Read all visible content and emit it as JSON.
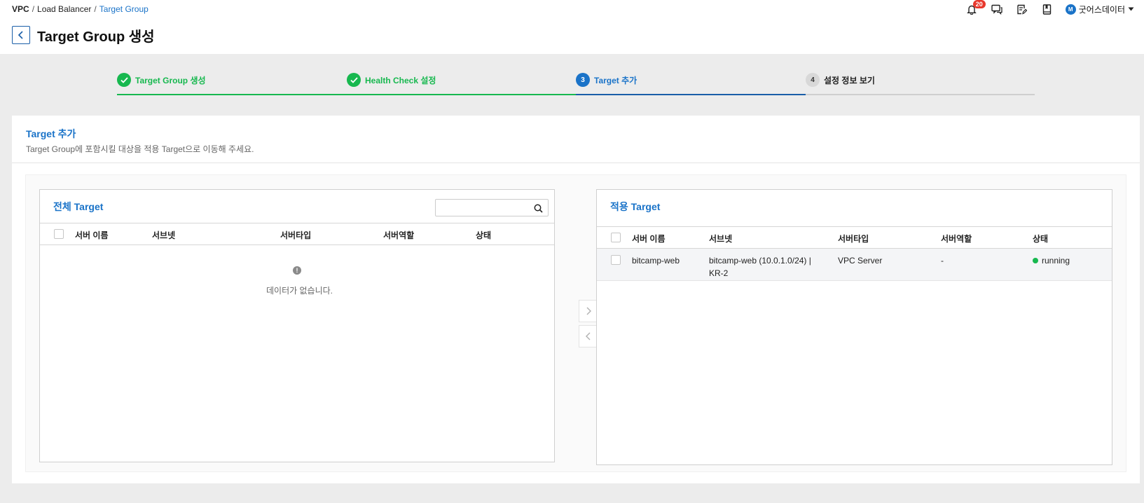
{
  "breadcrumb": {
    "items": [
      "VPC",
      "Load Balancer",
      "Target Group"
    ],
    "separator": "/"
  },
  "page_title": "Target Group 생성",
  "header": {
    "notification_count": "20",
    "user_initial": "M",
    "user_name": "굿어스데이터"
  },
  "stepper": [
    {
      "label": "Target Group 생성",
      "state": "done",
      "number": "1"
    },
    {
      "label": "Health Check 설정",
      "state": "done",
      "number": "2"
    },
    {
      "label": "Target 추가",
      "state": "active",
      "number": "3"
    },
    {
      "label": "설정 정보 보기",
      "state": "todo",
      "number": "4"
    }
  ],
  "section": {
    "title": "Target 추가",
    "description": "Target Group에 포함시킬 대상을 적용 Target으로 이동해 주세요."
  },
  "all_targets": {
    "title": "전체 Target",
    "search_value": "",
    "columns": [
      "서버 이름",
      "서브넷",
      "서버타입",
      "서버역할",
      "상태"
    ],
    "empty_text": "데이터가 없습니다."
  },
  "applied_targets": {
    "title": "적용 Target",
    "columns": [
      "서버 이름",
      "서브넷",
      "서버타입",
      "서버역할",
      "상태"
    ],
    "rows": [
      {
        "name": "bitcamp-web",
        "subnet_line1": "bitcamp-web (10.0.1.0/24) |",
        "subnet_line2": "KR-2",
        "type": "VPC Server",
        "role": "-",
        "status": "running"
      }
    ]
  },
  "colors": {
    "accent": "#1a73c8",
    "success": "#17b84f",
    "badge": "#e8382d"
  }
}
